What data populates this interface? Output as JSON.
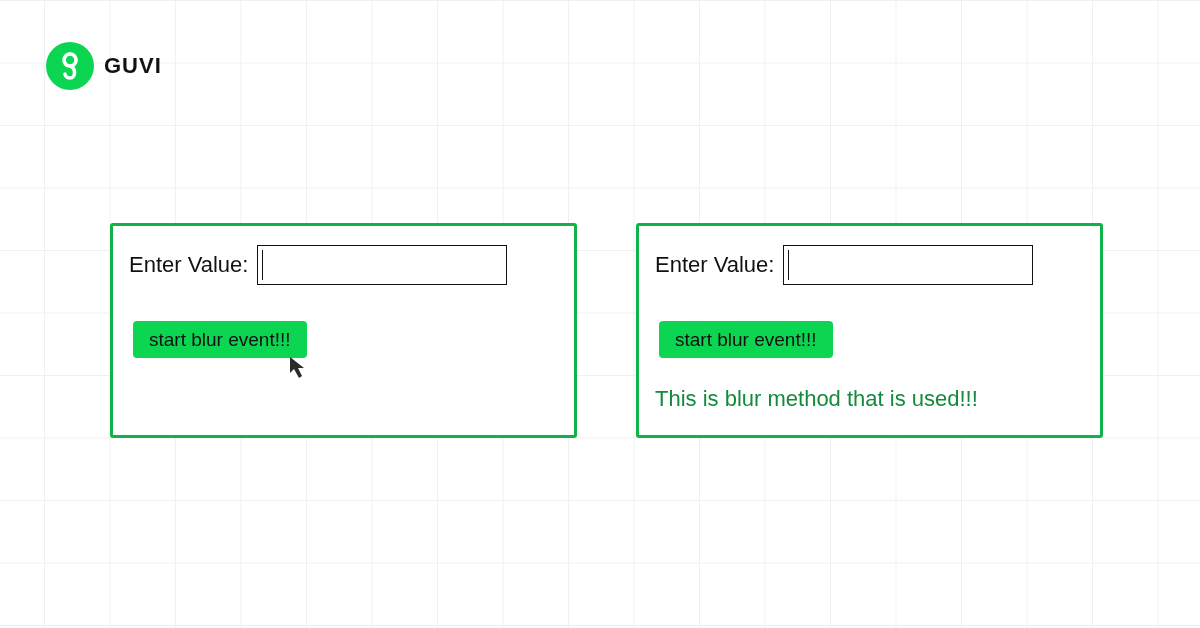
{
  "brand": {
    "name": "GUVI"
  },
  "panels": [
    {
      "label": "Enter Value:",
      "button": "start blur event!!!",
      "pointer": true
    },
    {
      "label": "Enter Value:",
      "button": "start blur event!!!",
      "pointer": false,
      "message": "This is blur method that is used!!!"
    }
  ]
}
